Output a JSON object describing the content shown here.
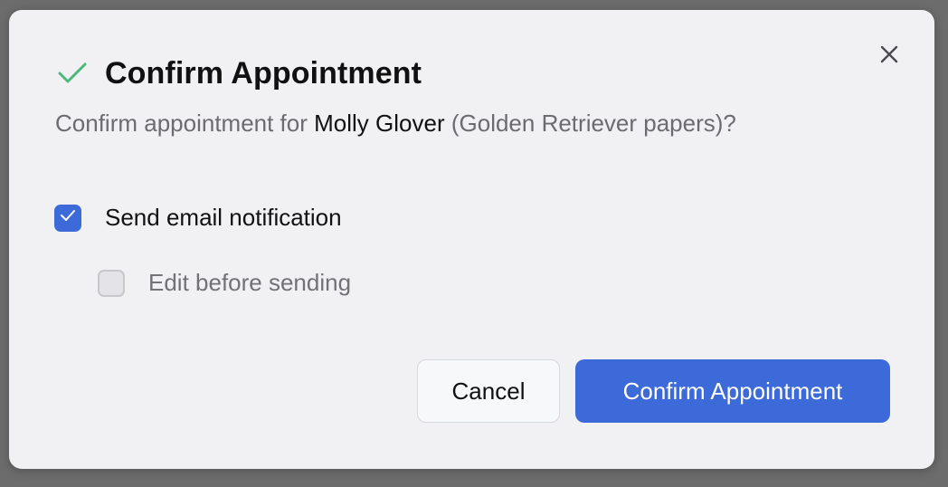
{
  "dialog": {
    "title": "Confirm Appointment",
    "message": {
      "prefix": "Confirm appointment for ",
      "client_name": "Molly Glover",
      "suffix": " (Golden Retriever papers)?"
    },
    "options": {
      "send_email": {
        "label": "Send email notification",
        "checked": true
      },
      "edit_before": {
        "label": "Edit before sending",
        "checked": false
      }
    },
    "buttons": {
      "cancel_label": "Cancel",
      "confirm_label": "Confirm Appointment"
    },
    "icons": {
      "title_icon": "checkmark-icon",
      "close_icon": "close-icon",
      "checkbox_check_icon": "checkmark-icon"
    }
  },
  "colors": {
    "accent": "#3c6ad8",
    "success": "#4cb87a",
    "dialog_bg": "#f1f1f4",
    "backdrop": "#6c6c6c"
  }
}
